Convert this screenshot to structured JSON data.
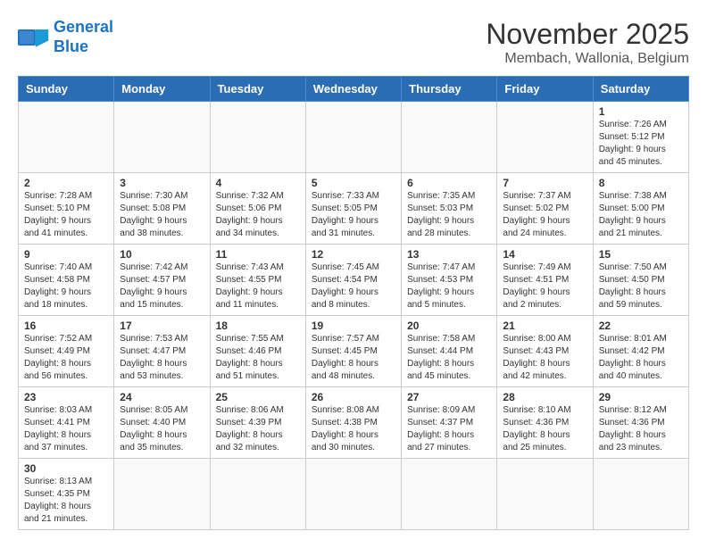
{
  "header": {
    "logo_general": "General",
    "logo_blue": "Blue",
    "month": "November 2025",
    "location": "Membach, Wallonia, Belgium"
  },
  "weekdays": [
    "Sunday",
    "Monday",
    "Tuesday",
    "Wednesday",
    "Thursday",
    "Friday",
    "Saturday"
  ],
  "weeks": [
    [
      {
        "day": "",
        "content": ""
      },
      {
        "day": "",
        "content": ""
      },
      {
        "day": "",
        "content": ""
      },
      {
        "day": "",
        "content": ""
      },
      {
        "day": "",
        "content": ""
      },
      {
        "day": "",
        "content": ""
      },
      {
        "day": "1",
        "content": "Sunrise: 7:26 AM\nSunset: 5:12 PM\nDaylight: 9 hours and 45 minutes."
      }
    ],
    [
      {
        "day": "2",
        "content": "Sunrise: 7:28 AM\nSunset: 5:10 PM\nDaylight: 9 hours and 41 minutes."
      },
      {
        "day": "3",
        "content": "Sunrise: 7:30 AM\nSunset: 5:08 PM\nDaylight: 9 hours and 38 minutes."
      },
      {
        "day": "4",
        "content": "Sunrise: 7:32 AM\nSunset: 5:06 PM\nDaylight: 9 hours and 34 minutes."
      },
      {
        "day": "5",
        "content": "Sunrise: 7:33 AM\nSunset: 5:05 PM\nDaylight: 9 hours and 31 minutes."
      },
      {
        "day": "6",
        "content": "Sunrise: 7:35 AM\nSunset: 5:03 PM\nDaylight: 9 hours and 28 minutes."
      },
      {
        "day": "7",
        "content": "Sunrise: 7:37 AM\nSunset: 5:02 PM\nDaylight: 9 hours and 24 minutes."
      },
      {
        "day": "8",
        "content": "Sunrise: 7:38 AM\nSunset: 5:00 PM\nDaylight: 9 hours and 21 minutes."
      }
    ],
    [
      {
        "day": "9",
        "content": "Sunrise: 7:40 AM\nSunset: 4:58 PM\nDaylight: 9 hours and 18 minutes."
      },
      {
        "day": "10",
        "content": "Sunrise: 7:42 AM\nSunset: 4:57 PM\nDaylight: 9 hours and 15 minutes."
      },
      {
        "day": "11",
        "content": "Sunrise: 7:43 AM\nSunset: 4:55 PM\nDaylight: 9 hours and 11 minutes."
      },
      {
        "day": "12",
        "content": "Sunrise: 7:45 AM\nSunset: 4:54 PM\nDaylight: 9 hours and 8 minutes."
      },
      {
        "day": "13",
        "content": "Sunrise: 7:47 AM\nSunset: 4:53 PM\nDaylight: 9 hours and 5 minutes."
      },
      {
        "day": "14",
        "content": "Sunrise: 7:49 AM\nSunset: 4:51 PM\nDaylight: 9 hours and 2 minutes."
      },
      {
        "day": "15",
        "content": "Sunrise: 7:50 AM\nSunset: 4:50 PM\nDaylight: 8 hours and 59 minutes."
      }
    ],
    [
      {
        "day": "16",
        "content": "Sunrise: 7:52 AM\nSunset: 4:49 PM\nDaylight: 8 hours and 56 minutes."
      },
      {
        "day": "17",
        "content": "Sunrise: 7:53 AM\nSunset: 4:47 PM\nDaylight: 8 hours and 53 minutes."
      },
      {
        "day": "18",
        "content": "Sunrise: 7:55 AM\nSunset: 4:46 PM\nDaylight: 8 hours and 51 minutes."
      },
      {
        "day": "19",
        "content": "Sunrise: 7:57 AM\nSunset: 4:45 PM\nDaylight: 8 hours and 48 minutes."
      },
      {
        "day": "20",
        "content": "Sunrise: 7:58 AM\nSunset: 4:44 PM\nDaylight: 8 hours and 45 minutes."
      },
      {
        "day": "21",
        "content": "Sunrise: 8:00 AM\nSunset: 4:43 PM\nDaylight: 8 hours and 42 minutes."
      },
      {
        "day": "22",
        "content": "Sunrise: 8:01 AM\nSunset: 4:42 PM\nDaylight: 8 hours and 40 minutes."
      }
    ],
    [
      {
        "day": "23",
        "content": "Sunrise: 8:03 AM\nSunset: 4:41 PM\nDaylight: 8 hours and 37 minutes."
      },
      {
        "day": "24",
        "content": "Sunrise: 8:05 AM\nSunset: 4:40 PM\nDaylight: 8 hours and 35 minutes."
      },
      {
        "day": "25",
        "content": "Sunrise: 8:06 AM\nSunset: 4:39 PM\nDaylight: 8 hours and 32 minutes."
      },
      {
        "day": "26",
        "content": "Sunrise: 8:08 AM\nSunset: 4:38 PM\nDaylight: 8 hours and 30 minutes."
      },
      {
        "day": "27",
        "content": "Sunrise: 8:09 AM\nSunset: 4:37 PM\nDaylight: 8 hours and 27 minutes."
      },
      {
        "day": "28",
        "content": "Sunrise: 8:10 AM\nSunset: 4:36 PM\nDaylight: 8 hours and 25 minutes."
      },
      {
        "day": "29",
        "content": "Sunrise: 8:12 AM\nSunset: 4:36 PM\nDaylight: 8 hours and 23 minutes."
      }
    ],
    [
      {
        "day": "30",
        "content": "Sunrise: 8:13 AM\nSunset: 4:35 PM\nDaylight: 8 hours and 21 minutes."
      },
      {
        "day": "",
        "content": ""
      },
      {
        "day": "",
        "content": ""
      },
      {
        "day": "",
        "content": ""
      },
      {
        "day": "",
        "content": ""
      },
      {
        "day": "",
        "content": ""
      },
      {
        "day": "",
        "content": ""
      }
    ]
  ]
}
